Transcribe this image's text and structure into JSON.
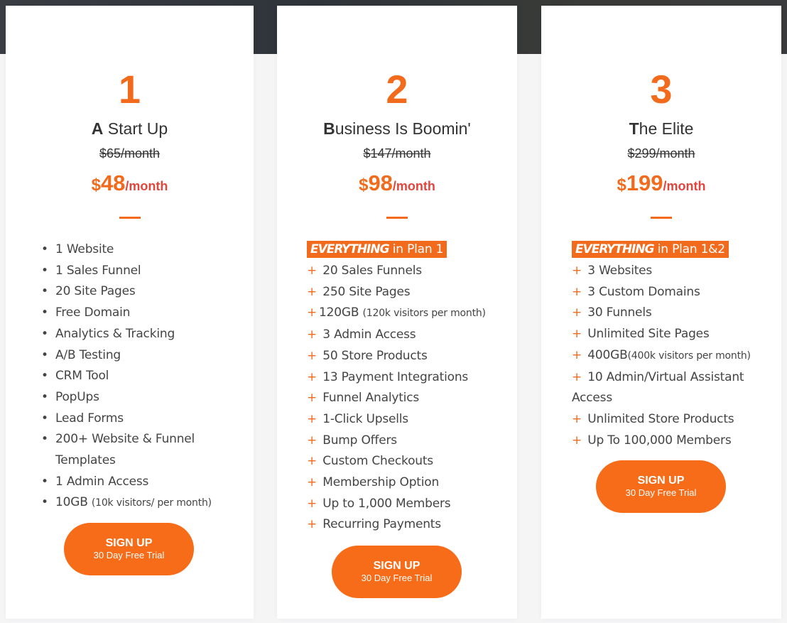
{
  "colors": {
    "accent": "#f26b1d",
    "per_month": "#e2453c",
    "button": "#f76c18",
    "text": "#444444"
  },
  "plans": [
    {
      "number": "1",
      "name_initial": "A",
      "name_rest": " Start Up",
      "old_price": "$65/month",
      "currency": "$",
      "price": "48",
      "per": "/month",
      "everything_label": null,
      "features": [
        {
          "main": "1 Website"
        },
        {
          "main": "1 Sales Funnel"
        },
        {
          "main": "20 Site Pages"
        },
        {
          "main": "Free Domain"
        },
        {
          "main": "Analytics & Tracking"
        },
        {
          "main": "A/B Testing"
        },
        {
          "main": "CRM Tool"
        },
        {
          "main": "PopUps"
        },
        {
          "main": "Lead Forms"
        },
        {
          "main": "200+ Website & Funnel Templates"
        },
        {
          "main": "1 Admin Access"
        },
        {
          "main": "10GB ",
          "note": "(10k visitors/ per month)"
        }
      ],
      "button": {
        "title": "SIGN UP",
        "subtitle": "30 Day Free Trial"
      }
    },
    {
      "number": "2",
      "name_initial": "B",
      "name_rest": "usiness Is Boomin'",
      "old_price": "$147/month",
      "currency": "$",
      "price": "98",
      "per": "/month",
      "everything_label": {
        "em": "EVERYTHING",
        "rest": " in Plan 1"
      },
      "features": [
        {
          "prefix": "+ ",
          "main": "20 Sales Funnels"
        },
        {
          "prefix": "+ ",
          "main": "250 Site Pages"
        },
        {
          "prefix": "+",
          "main": "120GB ",
          "note": "(120k visitors per month)"
        },
        {
          "prefix": "+ ",
          "main": "3 Admin Access"
        },
        {
          "prefix": "+ ",
          "main": "50 Store Products"
        },
        {
          "prefix": "+ ",
          "main": "13 Payment Integrations"
        },
        {
          "prefix": "+ ",
          "main": "Funnel Analytics"
        },
        {
          "prefix": "+ ",
          "main": "1-Click Upsells"
        },
        {
          "prefix": "+ ",
          "main": "Bump Offers"
        },
        {
          "prefix": "+ ",
          "main": "Custom Checkouts"
        },
        {
          "prefix": "+ ",
          "main": "Membership Option"
        },
        {
          "prefix": "+ ",
          "main": "Up to 1,000 Members"
        },
        {
          "prefix": "+ ",
          "main": "Recurring Payments"
        }
      ],
      "button": {
        "title": "SIGN UP",
        "subtitle": "30 Day Free Trial"
      }
    },
    {
      "number": "3",
      "name_initial": "T",
      "name_rest": "he Elite",
      "old_price": "$299/month",
      "currency": "$",
      "price": "199",
      "per": "/month",
      "everything_label": {
        "em": "EVERYTHING",
        "rest": " in Plan 1&2"
      },
      "features": [
        {
          "prefix": "+ ",
          "main": "3 Websites"
        },
        {
          "prefix": "+ ",
          "main": "3 Custom Domains"
        },
        {
          "prefix": "+ ",
          "main": "30 Funnels"
        },
        {
          "prefix": "+ ",
          "main": "Unlimited Site Pages"
        },
        {
          "prefix": "+ ",
          "main": "400GB",
          "note": "(400k visitors per month)"
        },
        {
          "prefix": "+ ",
          "main": "10 Admin/Virtual Assistant Access"
        },
        {
          "prefix": "+ ",
          "main": "Unlimited Store Products"
        },
        {
          "prefix": "+ ",
          "main": "Up To 100,000 Members"
        }
      ],
      "button": {
        "title": "SIGN UP",
        "subtitle": "30 Day Free Trial"
      }
    }
  ]
}
